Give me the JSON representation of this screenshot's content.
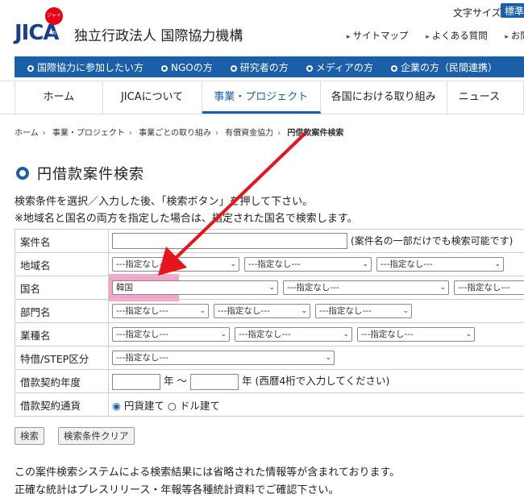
{
  "header": {
    "logo_text": "JICA",
    "logo_badge": "ジャイカ",
    "org_name": "独立行政法人 国際協力機構",
    "font_size_label": "文字サイズ",
    "font_size_value": "標準",
    "util_links": [
      "サイトマップ",
      "よくある質問",
      "お問合せ"
    ]
  },
  "audience_bar": [
    "国際協力に参加したい方",
    "NGOの方",
    "研究者の方",
    "メディアの方",
    "企業の方（民間連携）"
  ],
  "global_nav": [
    {
      "label": "ホーム",
      "w": 0
    },
    {
      "label": "JICAについて"
    },
    {
      "label": "事業・プロジェクト"
    },
    {
      "label": "各国における取り組み"
    },
    {
      "label": "ニュース"
    }
  ],
  "breadcrumb": [
    "ホーム",
    "事業・プロジェクト",
    "事業ごとの取り組み",
    "有償資金協力",
    "円借款案件検索"
  ],
  "page_title": "円借款案件検索",
  "intro": [
    "検索条件を選択／入力した後、「検索ボタン」を押して下さい。",
    "※地域名と国名の両方を指定した場合は、指定された国名で検索します。"
  ],
  "form": {
    "case_name_label": "案件名",
    "case_name_hint": "(案件名の一部だけでも検索可能です)",
    "region_label": "地域名",
    "country_label": "国名",
    "country_value": "韓国",
    "sector_label": "部門名",
    "subsector_label": "業種名",
    "step_label": "特借/STEP区分",
    "year_label": "借款契約年度",
    "year_unit": "年",
    "year_tilde": "〜",
    "year_hint": "年 (西暦4桁で入力してください)",
    "currency_label": "借款契約通貨",
    "currency_yen": "円貨建て",
    "currency_dollar": "ドル建て",
    "unselected": "---指定なし---"
  },
  "buttons": {
    "search": "検索",
    "clear": "検索条件クリア"
  },
  "notes": [
    "この案件検索システムによる検索結果には省略された情報等が含まれております。",
    "正確な統計はプレスリリース・年報等各種統計資料でご確認下さい。"
  ]
}
